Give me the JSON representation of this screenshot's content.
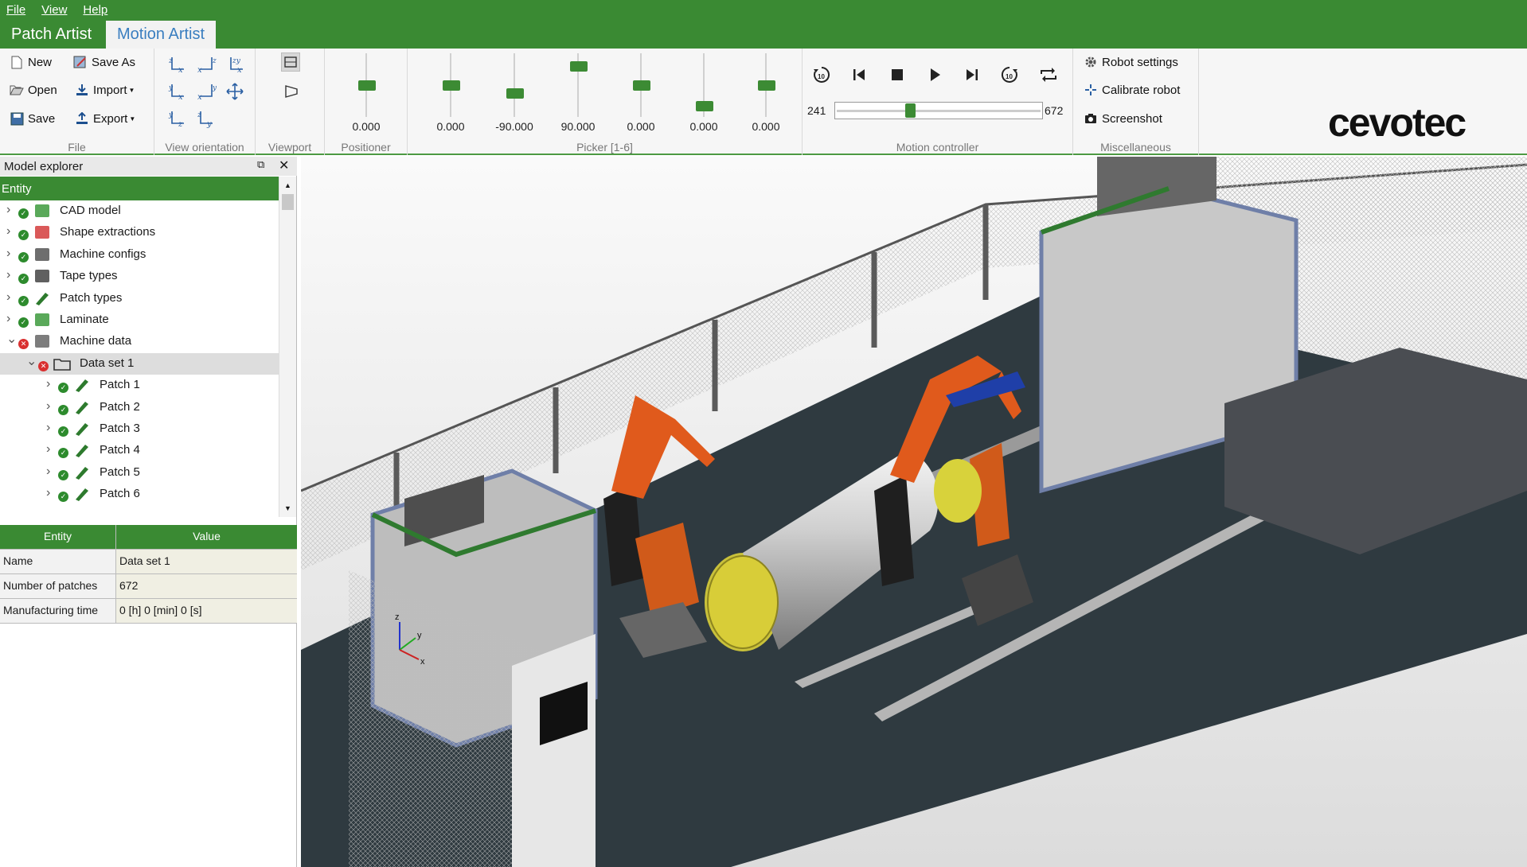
{
  "menu": {
    "file": "File",
    "view": "View",
    "help": "Help"
  },
  "tabs": {
    "patch_artist": "Patch Artist",
    "motion_artist": "Motion Artist"
  },
  "ribbon": {
    "file": {
      "label": "File",
      "new": "New",
      "save_as": "Save As",
      "open": "Open",
      "import": "Import",
      "export": "Export",
      "save": "Save"
    },
    "view_orientation": {
      "label": "View orientation"
    },
    "viewport": {
      "label": "Viewport"
    },
    "positioner": {
      "label": "Positioner",
      "value": "0.000",
      "level": 0.5
    },
    "picker": {
      "label": "Picker [1-6]",
      "values": [
        "0.000",
        "-90.000",
        "90.000",
        "0.000",
        "0.000",
        "0.000"
      ],
      "levels": [
        0.5,
        0.35,
        0.85,
        0.5,
        0.1,
        0.5
      ]
    },
    "motion_controller": {
      "label": "Motion controller",
      "current": "241",
      "total": "672",
      "progress": 0.36
    },
    "misc": {
      "label": "Miscellaneous",
      "robot_settings": "Robot settings",
      "calibrate_robot": "Calibrate robot",
      "screenshot": "Screenshot"
    },
    "logo": "cevotec"
  },
  "explorer": {
    "title": "Model explorer",
    "entity_header": "Entity",
    "items": [
      {
        "label": "CAD model",
        "status": "ok",
        "icon": "cube-icon"
      },
      {
        "label": "Shape extractions",
        "status": "ok",
        "icon": "shape-icon"
      },
      {
        "label": "Machine configs",
        "status": "ok",
        "icon": "gear-icon"
      },
      {
        "label": "Tape types",
        "status": "ok",
        "icon": "tape-icon"
      },
      {
        "label": "Patch types",
        "status": "ok",
        "icon": "patch-icon"
      },
      {
        "label": "Laminate",
        "status": "ok",
        "icon": "laminate-icon"
      },
      {
        "label": "Machine data",
        "status": "err",
        "icon": "machine-icon"
      },
      {
        "label": "Data set 1",
        "status": "err",
        "icon": "folder-icon"
      },
      {
        "label": "Patch 1",
        "status": "ok",
        "icon": "patch-icon"
      },
      {
        "label": "Patch 2",
        "status": "ok",
        "icon": "patch-icon"
      },
      {
        "label": "Patch 3",
        "status": "ok",
        "icon": "patch-icon"
      },
      {
        "label": "Patch 4",
        "status": "ok",
        "icon": "patch-icon"
      },
      {
        "label": "Patch 5",
        "status": "ok",
        "icon": "patch-icon"
      },
      {
        "label": "Patch 6",
        "status": "ok",
        "icon": "patch-icon"
      }
    ]
  },
  "properties": {
    "col_entity": "Entity",
    "col_value": "Value",
    "rows": [
      {
        "name": "Name",
        "value": "Data set 1"
      },
      {
        "name": "Number of patches",
        "value": "672"
      },
      {
        "name": "Manufacturing time",
        "value": "0 [h] 0 [min] 0 [s]"
      }
    ]
  },
  "axes": {
    "z": "z",
    "y": "y",
    "x": "x"
  }
}
